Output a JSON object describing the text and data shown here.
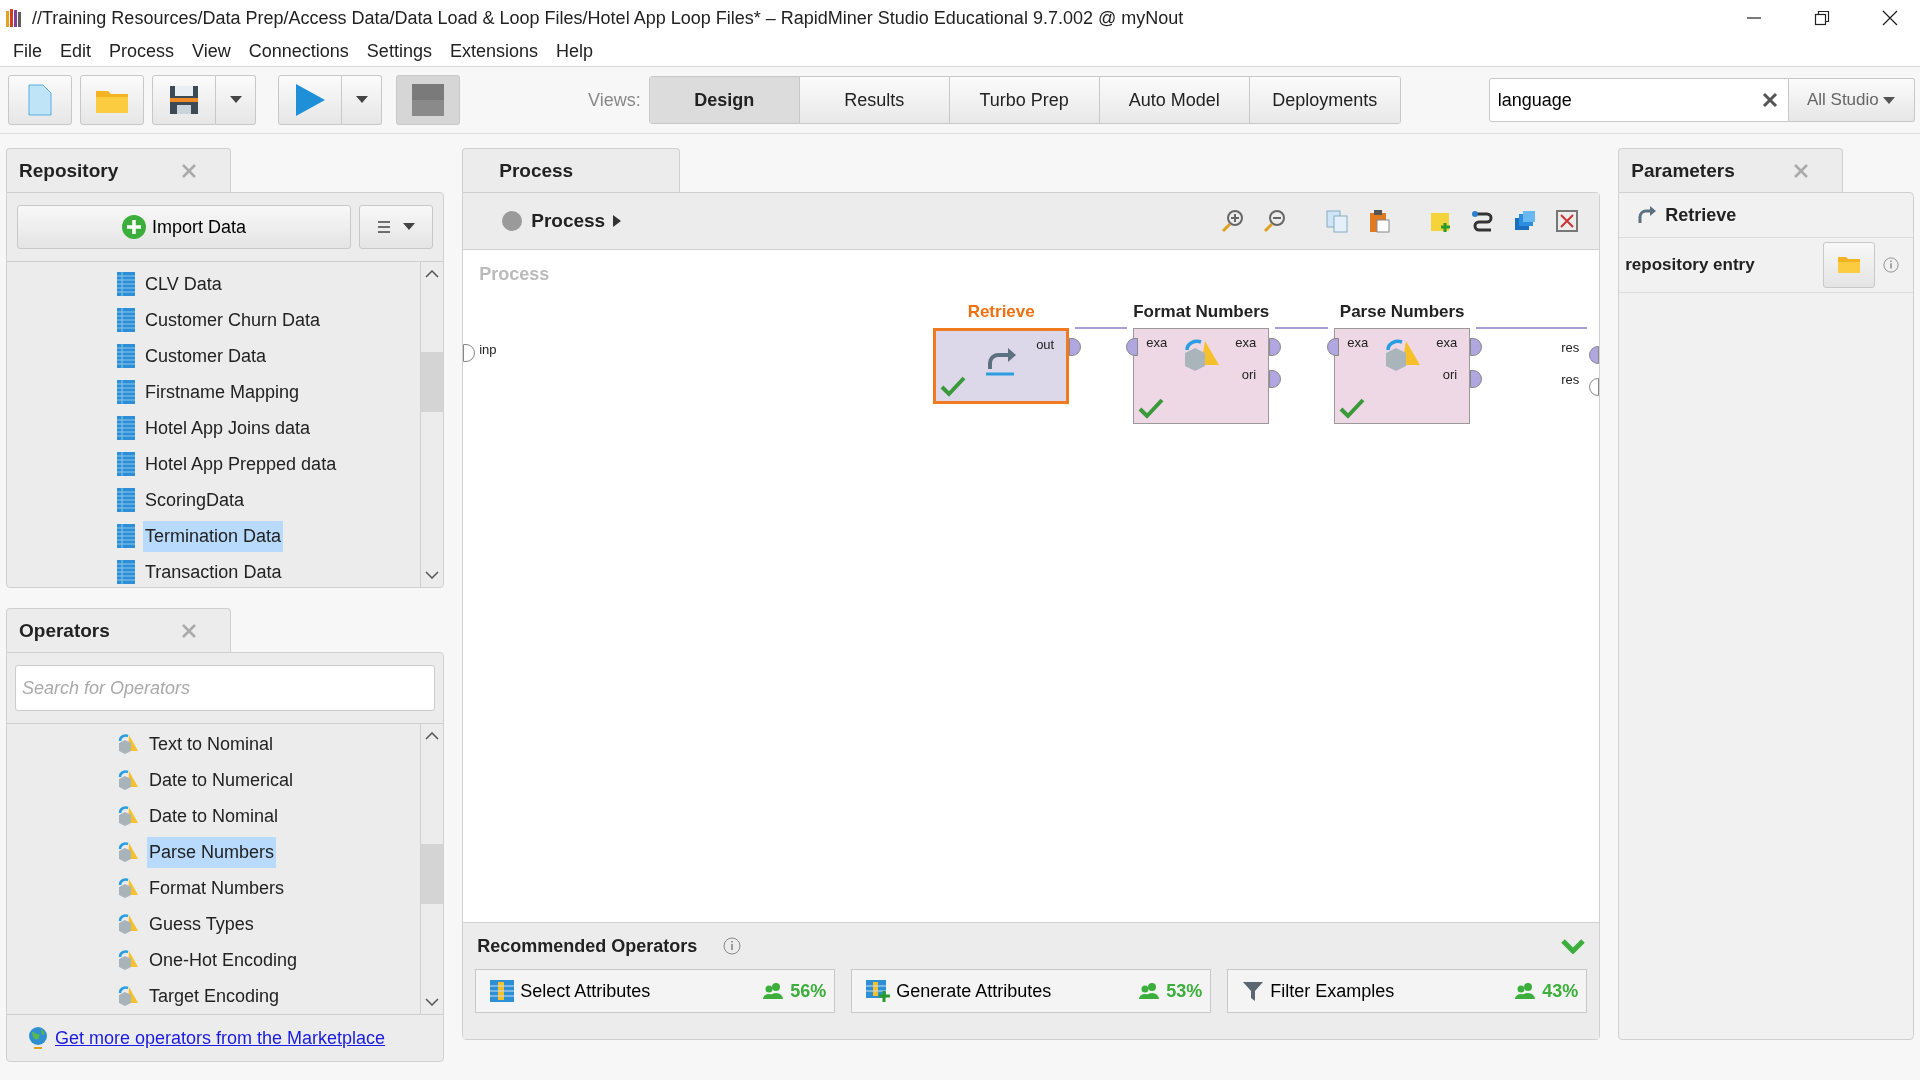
{
  "window": {
    "title": "//Training Resources/Data Prep/Access Data/Data Load & Loop Files/Hotel App Loop Files* – RapidMiner Studio Educational 9.7.002 @ myNout"
  },
  "menu": [
    "File",
    "Edit",
    "Process",
    "View",
    "Connections",
    "Settings",
    "Extensions",
    "Help"
  ],
  "views": {
    "label": "Views:",
    "tabs": [
      {
        "label": "Design",
        "selected": true
      },
      {
        "label": "Results",
        "selected": false
      },
      {
        "label": "Turbo Prep",
        "selected": false
      },
      {
        "label": "Auto Model",
        "selected": false
      },
      {
        "label": "Deployments",
        "selected": false
      }
    ]
  },
  "search": {
    "value": "language",
    "scope": "All Studio"
  },
  "repository": {
    "title": "Repository",
    "import_button": "Import Data",
    "items": [
      {
        "label": "CLV Data",
        "selected": false
      },
      {
        "label": "Customer Churn Data",
        "selected": false
      },
      {
        "label": "Customer Data",
        "selected": false
      },
      {
        "label": "Firstname Mapping",
        "selected": false
      },
      {
        "label": "Hotel App Joins data",
        "selected": false
      },
      {
        "label": "Hotel App Prepped data",
        "selected": false
      },
      {
        "label": "ScoringData",
        "selected": false
      },
      {
        "label": "Termination Data",
        "selected": true
      },
      {
        "label": "Transaction Data",
        "selected": false
      }
    ]
  },
  "operators": {
    "title": "Operators",
    "search_placeholder": "Search for Operators",
    "items": [
      {
        "label": "Text to Nominal",
        "selected": false
      },
      {
        "label": "Date to Numerical",
        "selected": false
      },
      {
        "label": "Date to Nominal",
        "selected": false
      },
      {
        "label": "Parse Numbers",
        "selected": true
      },
      {
        "label": "Format Numbers",
        "selected": false
      },
      {
        "label": "Guess Types",
        "selected": false
      },
      {
        "label": "One-Hot Encoding",
        "selected": false
      },
      {
        "label": "Target Encoding",
        "selected": false
      }
    ],
    "marketplace_link": "Get more operators from the Marketplace"
  },
  "process": {
    "tab": "Process",
    "breadcrumb": "Process",
    "canvas_label": "Process",
    "input_port": "inp",
    "output_ports": [
      {
        "label": "res",
        "connected": true
      },
      {
        "label": "res",
        "connected": false
      }
    ],
    "nodes": [
      {
        "title": "Retrieve",
        "kind": "retrieve",
        "selected": true,
        "valid": true,
        "outputs": [
          "out"
        ]
      },
      {
        "title": "Format Numbers",
        "kind": "blending",
        "selected": false,
        "valid": true,
        "inputs": [
          "exa"
        ],
        "outputs": [
          "exa",
          "ori"
        ]
      },
      {
        "title": "Parse Numbers",
        "kind": "blending",
        "selected": false,
        "valid": true,
        "inputs": [
          "exa"
        ],
        "outputs": [
          "exa",
          "ori"
        ]
      }
    ]
  },
  "recommended": {
    "title": "Recommended Operators",
    "items": [
      {
        "label": "Select Attributes",
        "kind": "select",
        "share": "56%"
      },
      {
        "label": "Generate Attributes",
        "kind": "generate",
        "share": "53%"
      },
      {
        "label": "Filter Examples",
        "kind": "filter",
        "share": "43%"
      }
    ]
  },
  "parameters": {
    "title": "Parameters",
    "operator": "Retrieve",
    "rows": [
      {
        "label": "repository entry"
      }
    ]
  }
}
